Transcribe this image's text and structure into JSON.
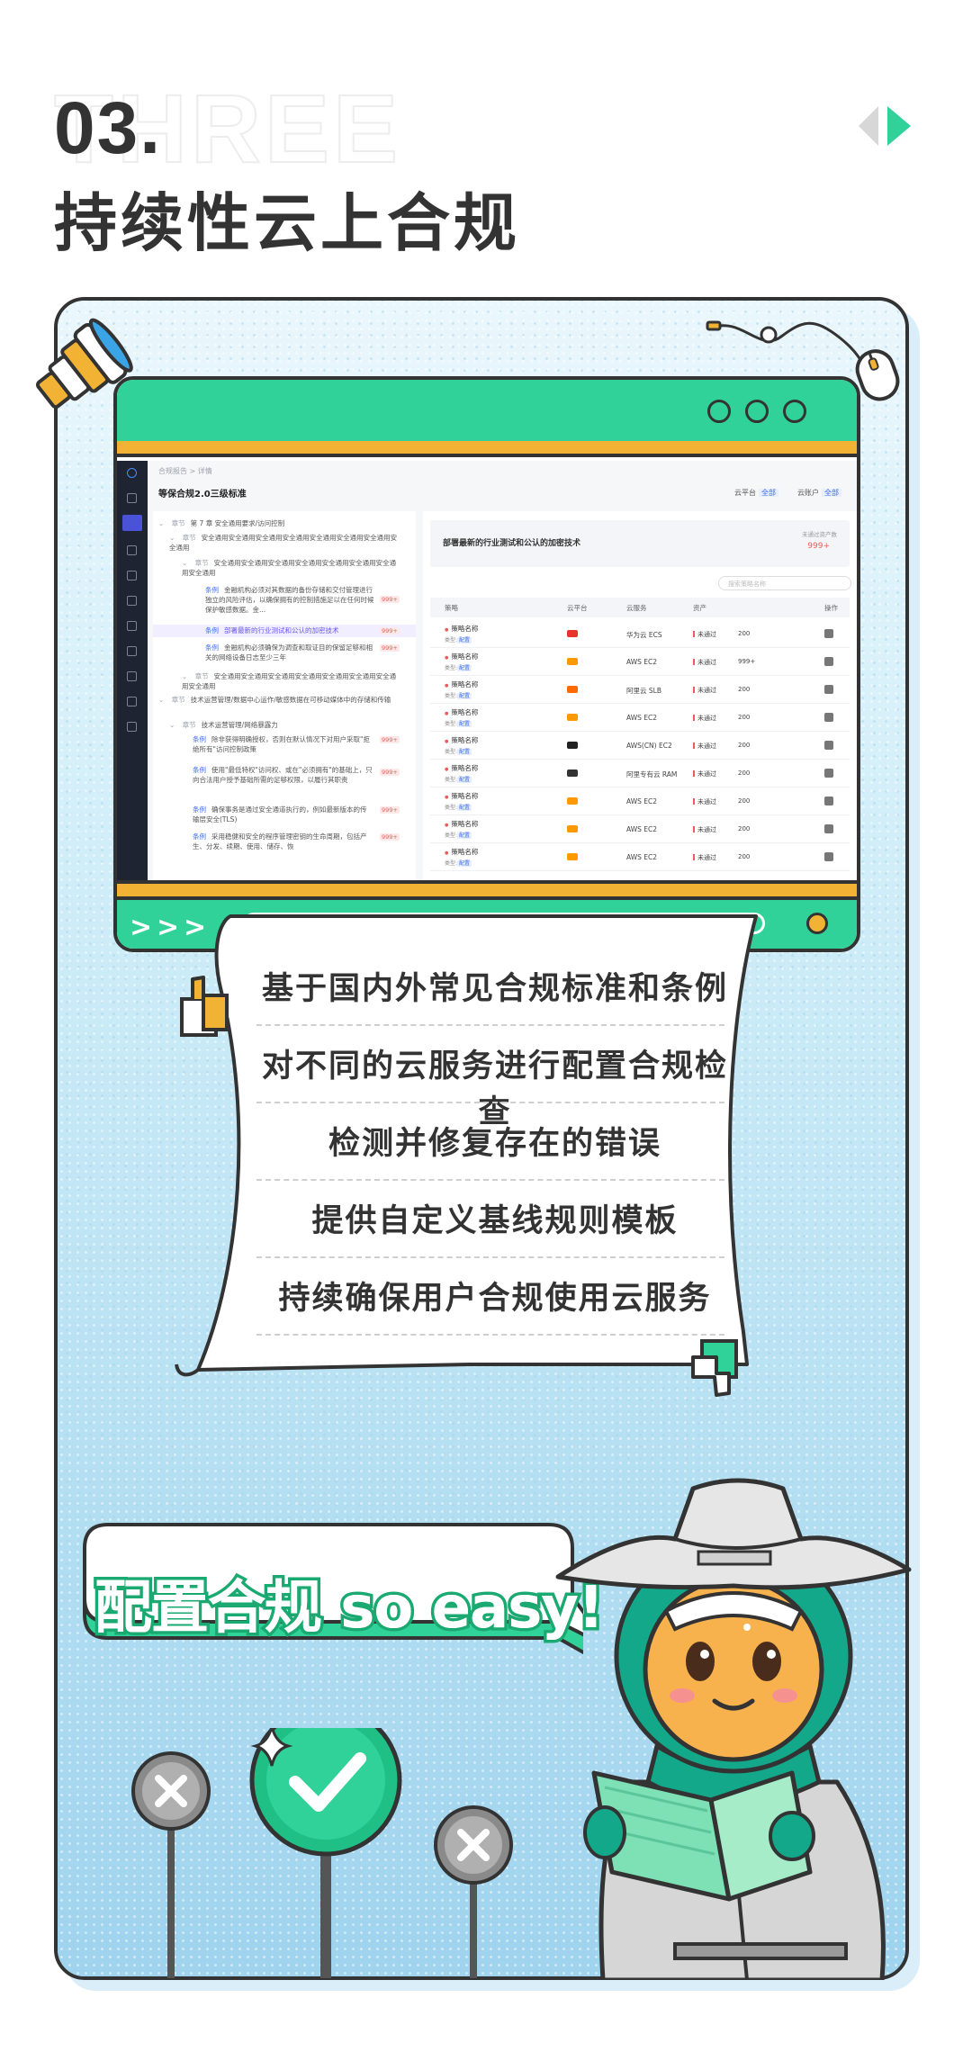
{
  "header": {
    "ghost_word": "THREE",
    "section_number": "03.",
    "section_title": "持续性云上合规"
  },
  "screenshot": {
    "breadcrumb": "合规报告 > 详情",
    "standard_title": "等保合规2.0三级标准",
    "filters": [
      {
        "label": "云平台",
        "value": "全部"
      },
      {
        "label": "云账户",
        "value": "全部"
      }
    ],
    "tree": [
      {
        "kind": "章节",
        "text": "第 7 章  安全通用要求/访问控制"
      },
      {
        "kind": "章节",
        "text": "安全通用安全通用安全通用安全通用安全通用安全通用安全通用安全通用"
      },
      {
        "kind": "章节",
        "text": "安全通用安全通用安全通用安全通用安全通用安全通用安全通用安全通用"
      },
      {
        "kind": "条例",
        "text": "金融机构必须对其数据的备份存储和交付管理进行独立的风险评估，以确保拥有的控制措施足以在任何时候保护敏感数据。金...",
        "count": "999+"
      },
      {
        "kind": "条例",
        "text": "部署最新的行业测试和公认的加密技术",
        "count": "999+",
        "selected": true
      },
      {
        "kind": "条例",
        "text": "金融机构必须确保为调查和取证目的保留足够和相关的网络设备日志至少三年",
        "count": "999+"
      },
      {
        "kind": "章节",
        "text": "安全通用安全通用安全通用安全通用安全通用安全通用安全通用安全通用"
      },
      {
        "kind": "章节",
        "text": "技术运营管理/数据中心运作/敏感数据在可移动媒体中的存储和传输"
      },
      {
        "kind": "章节",
        "text": "技术运营管理/网络暴露力"
      },
      {
        "kind": "条例",
        "text": "除非获得明确授权，否则在默认情况下对用户采取\"拒绝所有\"访问控制政策",
        "count": "999+"
      },
      {
        "kind": "条例",
        "text": "使用\"最低特权\"访问权、或在\"必须拥有\"的基础上，只向合法用户授予基础所需的足够权限，以履行其职责",
        "count": "999+"
      },
      {
        "kind": "条例",
        "text": "确保事务是通过安全通道执行的，例如最新版本的传输层安全(TLS)",
        "count": "999+"
      },
      {
        "kind": "条例",
        "text": "采用稳健和安全的程序管理密钥的生命周期，包括产生、分发、续期、使用、储存、恢",
        "count": "999+"
      }
    ],
    "panel_title": "部署最新的行业测试和公认的加密技术",
    "panel_count_label": "未通过资产数",
    "panel_count": "999+",
    "search_placeholder": "搜索策略名称",
    "columns": [
      "策略",
      "云平台",
      "云服务",
      "资产",
      "操作"
    ],
    "rows": [
      {
        "name": "策略名称",
        "type_label": "类型:",
        "type": "配置",
        "platform": "huawei",
        "platform_color": "#e5352d",
        "service": "华为云 ECS",
        "status": "未通过",
        "assets": "200"
      },
      {
        "name": "策略名称",
        "type_label": "类型:",
        "type": "配置",
        "platform": "aws",
        "platform_color": "#ff9900",
        "service": "AWS EC2",
        "status": "未通过",
        "assets": "999+"
      },
      {
        "name": "策略名称",
        "type_label": "类型:",
        "type": "配置",
        "platform": "aliyun",
        "platform_color": "#ff6a00",
        "service": "阿里云 SLB",
        "status": "未通过",
        "assets": "200"
      },
      {
        "name": "策略名称",
        "type_label": "类型:",
        "type": "配置",
        "platform": "aws",
        "platform_color": "#ff9900",
        "service": "AWS EC2",
        "status": "未通过",
        "assets": "200"
      },
      {
        "name": "策略名称",
        "type_label": "类型:",
        "type": "配置",
        "platform": "aws-cn",
        "platform_color": "#222222",
        "service": "AWS(CN) EC2",
        "status": "未通过",
        "assets": "200"
      },
      {
        "name": "策略名称",
        "type_label": "类型:",
        "type": "配置",
        "platform": "aliyun",
        "platform_color": "#333333",
        "service": "阿里专有云 RAM",
        "status": "未通过",
        "assets": "200"
      },
      {
        "name": "策略名称",
        "type_label": "类型:",
        "type": "配置",
        "platform": "aws",
        "platform_color": "#ff9900",
        "service": "AWS EC2",
        "status": "未通过",
        "assets": "200"
      },
      {
        "name": "策略名称",
        "type_label": "类型:",
        "type": "配置",
        "platform": "aws",
        "platform_color": "#ff9900",
        "service": "AWS EC2",
        "status": "未通过",
        "assets": "200"
      },
      {
        "name": "策略名称",
        "type_label": "类型:",
        "type": "配置",
        "platform": "aws",
        "platform_color": "#ff9900",
        "service": "AWS EC2",
        "status": "未通过",
        "assets": "200"
      }
    ]
  },
  "features": [
    "基于国内外常见合规标准和条例",
    "对不同的云服务进行配置合规检查",
    "检测并修复存在的错误",
    "提供自定义基线规则模板",
    "持续确保用户合规使用云服务"
  ],
  "slogan": "配置合规 so easy!",
  "colors": {
    "brand_green": "#30d29a",
    "accent_orange": "#f2b233",
    "dark_outline": "#333333",
    "sky_blue": "#bfe6f5",
    "slogan_outline": "#1aa971"
  },
  "icons": [
    "prev-arrow-icon",
    "next-arrow-icon",
    "thumbs-up-icon",
    "thumbs-down-icon",
    "cross-sign-icon",
    "check-sign-icon",
    "telescope-icon",
    "mouse-icon",
    "sparkle-icon"
  ]
}
